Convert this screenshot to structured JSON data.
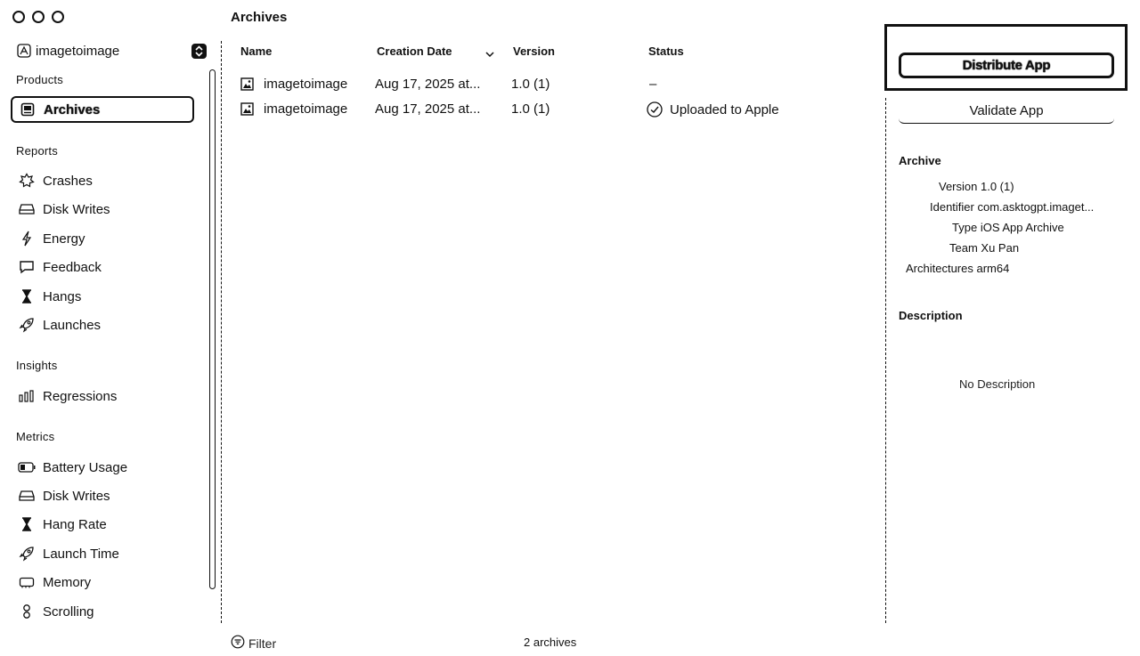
{
  "window": {
    "title": "Archives"
  },
  "sidebar": {
    "product": "imagetoimage",
    "sections": {
      "products": "Products",
      "reports": "Reports",
      "insights": "Insights",
      "metrics": "Metrics"
    },
    "products_items": [
      {
        "label": "Archives",
        "icon": "archive-icon",
        "selected": true
      }
    ],
    "reports_items": [
      {
        "label": "Crashes",
        "icon": "crash-icon"
      },
      {
        "label": "Disk Writes",
        "icon": "disk-icon"
      },
      {
        "label": "Energy",
        "icon": "bolt-icon"
      },
      {
        "label": "Feedback",
        "icon": "speech-bubble-icon"
      },
      {
        "label": "Hangs",
        "icon": "hourglass-icon"
      },
      {
        "label": "Launches",
        "icon": "rocket-icon"
      }
    ],
    "insights_items": [
      {
        "label": "Regressions",
        "icon": "bar-chart-icon"
      }
    ],
    "metrics_items": [
      {
        "label": "Battery Usage",
        "icon": "battery-icon"
      },
      {
        "label": "Disk Writes",
        "icon": "disk-icon"
      },
      {
        "label": "Hang Rate",
        "icon": "hourglass-icon"
      },
      {
        "label": "Launch Time",
        "icon": "rocket-icon"
      },
      {
        "label": "Memory",
        "icon": "memory-chip-icon"
      },
      {
        "label": "Scrolling",
        "icon": "scroll-icon"
      }
    ]
  },
  "table": {
    "columns": [
      "Name",
      "Creation Date",
      "Version",
      "Status"
    ],
    "rows": [
      {
        "name": "imagetoimage",
        "date": "Aug 17, 2025 at...",
        "version": "1.0 (1)",
        "status": "–"
      },
      {
        "name": "imagetoimage",
        "date": "Aug 17, 2025 at...",
        "version": "1.0 (1)",
        "status": "Uploaded to Apple"
      }
    ]
  },
  "footer": {
    "filter_label": "Filter",
    "count": "2 archives"
  },
  "inspector": {
    "distribute_label": "Distribute App",
    "validate_label": "Validate App",
    "archive_heading": "Archive",
    "fields": {
      "version_key": "Version",
      "version_val": "1.0 (1)",
      "identifier_key": "Identifier",
      "identifier_val": "com.asktogpt.imaget...",
      "type_key": "Type",
      "type_val": "iOS App Archive",
      "team_key": "Team",
      "team_val": "Xu Pan",
      "arch_key": "Architectures",
      "arch_val": "arm64"
    },
    "description_heading": "Description",
    "description_text": "No Description"
  }
}
